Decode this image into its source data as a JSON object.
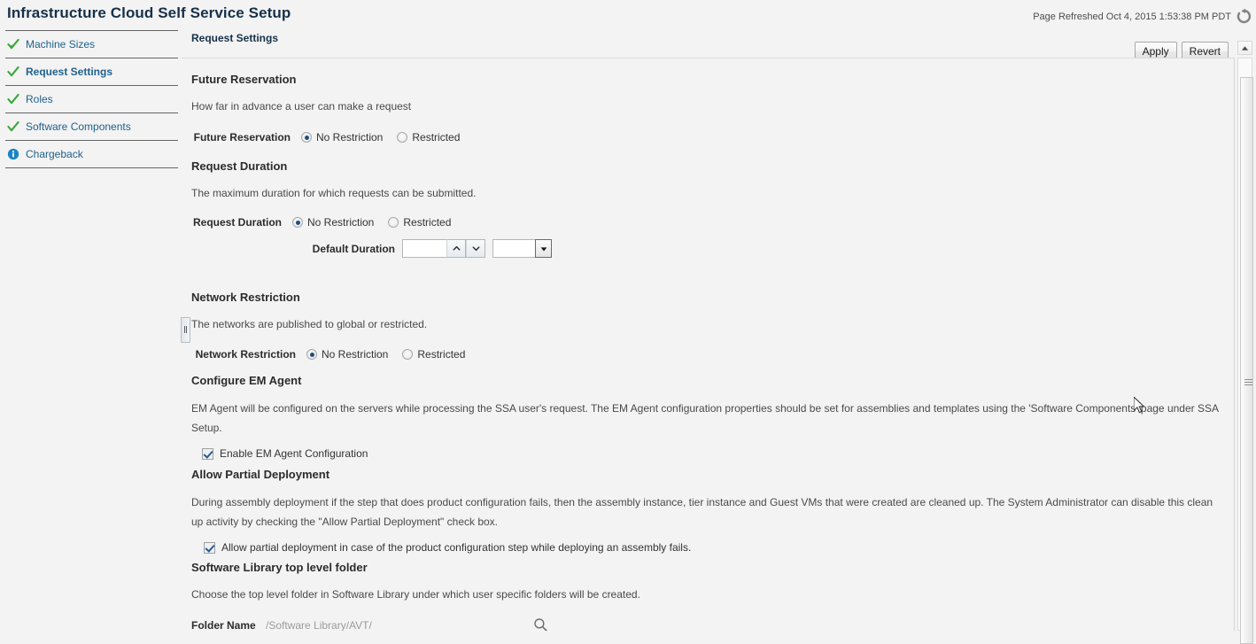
{
  "header": {
    "title": "Infrastructure Cloud Self Service Setup",
    "refresh_text": "Page Refreshed Oct 4, 2015 1:53:38 PM PDT",
    "refresh_icon": "refresh-icon"
  },
  "sidebar": {
    "items": [
      {
        "label": "Machine Sizes",
        "icon": "green-check-icon",
        "state": "complete",
        "current": false
      },
      {
        "label": "Request Settings",
        "icon": "green-check-icon",
        "state": "complete",
        "current": true
      },
      {
        "label": "Roles",
        "icon": "green-check-icon",
        "state": "complete",
        "current": false
      },
      {
        "label": "Software Components",
        "icon": "green-check-icon",
        "state": "complete",
        "current": false
      },
      {
        "label": "Chargeback",
        "icon": "blue-info-icon",
        "state": "info",
        "current": false
      }
    ]
  },
  "main": {
    "breadcrumb": "Request Settings",
    "toolbar": {
      "apply_label": "Apply",
      "revert_label": "Revert"
    },
    "sections": {
      "future_reservation": {
        "title": "Future Reservation",
        "description": "How far in advance a user can make a request",
        "field_label": "Future Reservation",
        "options": [
          "No Restriction",
          "Restricted"
        ],
        "selected": "No Restriction"
      },
      "request_duration": {
        "title": "Request Duration",
        "description": "The maximum duration for which requests can be submitted.",
        "field_label": "Request Duration",
        "options": [
          "No Restriction",
          "Restricted"
        ],
        "selected": "No Restriction",
        "default_duration_label": "Default Duration",
        "default_duration_value": "",
        "default_duration_unit": ""
      },
      "network_restriction": {
        "title": "Network Restriction",
        "description": "The networks are published to global or restricted.",
        "field_label": "Network Restriction",
        "options": [
          "No Restriction",
          "Restricted"
        ],
        "selected": "No Restriction"
      },
      "configure_em_agent": {
        "title": "Configure EM Agent",
        "description": "EM Agent will be configured on the servers while processing the SSA user's request. The EM Agent configuration properties should be set for assemblies and templates using the 'Software Components' page under SSA Setup.",
        "checkbox_label": "Enable EM Agent Configuration",
        "checked": true
      },
      "allow_partial_deployment": {
        "title": "Allow Partial Deployment",
        "description": "During assembly deployment if the step that does product configuration fails, then the assembly instance, tier instance and Guest VMs that were created are cleaned up. The System Administrator can disable this clean up activity by checking the \"Allow Partial Deployment\" check box.",
        "checkbox_label": "Allow partial deployment in case of the product configuration step while deploying an assembly fails.",
        "checked": true
      },
      "software_library_folder": {
        "title": "Software Library top level folder",
        "description": "Choose the top level folder in Software Library under which user specific folders will be created.",
        "field_label": "Folder Name",
        "value": "/Software Library/AVT/",
        "search_icon": "search-icon"
      }
    }
  },
  "colors": {
    "accent_link": "#21618c",
    "title": "#16304a",
    "check_green": "#3aa93a",
    "info_blue": "#1c84c6",
    "radio_selected": "#1f4e79",
    "page_bg": "#f3f3f3"
  }
}
